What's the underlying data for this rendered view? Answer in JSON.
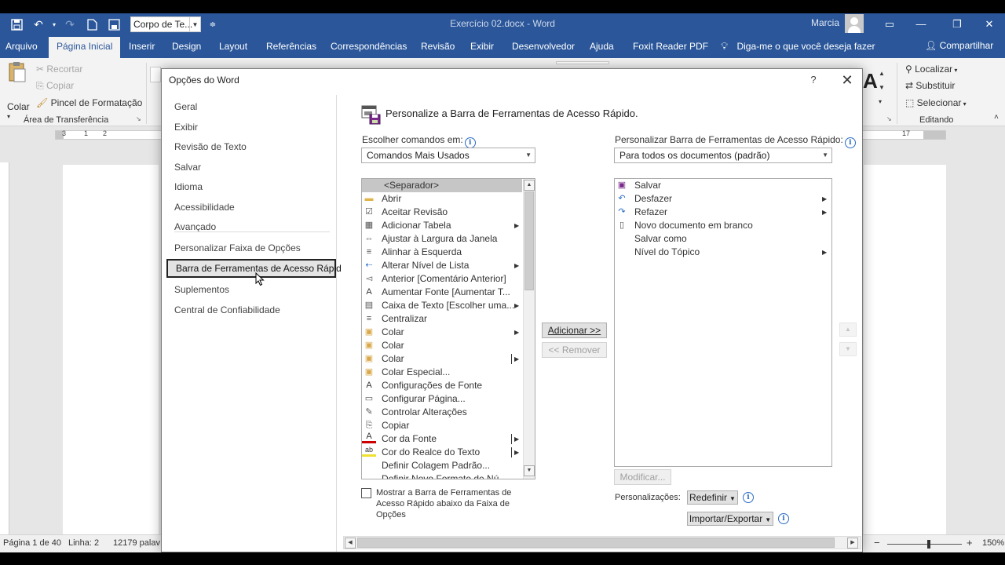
{
  "window": {
    "doc_title": "Exercício 02.docx  -  Word",
    "user": "Marcia",
    "style_box": "Corpo de Te...",
    "controls": {
      "ribbon_options": "▭",
      "minimize": "—",
      "restore": "❐",
      "close": "✕"
    }
  },
  "ribbon_tabs": [
    "Arquivo",
    "Página Inicial",
    "Inserir",
    "Design",
    "Layout",
    "Referências",
    "Correspondências",
    "Revisão",
    "Exibir",
    "Desenvolvedor",
    "Ajuda",
    "Foxit Reader PDF"
  ],
  "tell_me": "Diga-me o que você deseja fazer",
  "share": "Compartilhar",
  "clipboard": {
    "paste": "Colar",
    "cut": "Recortar",
    "copy": "Copiar",
    "format_painter": "Pincel de Formatação",
    "group_label": "Área de Transferência"
  },
  "editing": {
    "find": "Localizar",
    "replace": "Substituir",
    "select": "Selecionar",
    "group_label": "Editando"
  },
  "ruler": {
    "marks": [
      "3",
      "1",
      "2",
      "17"
    ]
  },
  "status": {
    "page": "Página 1 de 40",
    "line": "Linha: 2",
    "words": "12179 palav",
    "zoom": "150%",
    "zoom_minus": "−",
    "zoom_plus": "+"
  },
  "dialog": {
    "title": "Opções do Word",
    "help": "?",
    "close": "✕",
    "nav": {
      "items": [
        "Geral",
        "Exibir",
        "Revisão de Texto",
        "Salvar",
        "Idioma",
        "Acessibilidade",
        "Avançado",
        "Personalizar Faixa de Opções",
        "Barra de Ferramentas de Acesso Rápido",
        "Suplementos",
        "Central de Confiabilidade"
      ],
      "selected_index": 8
    },
    "section_title": "Personalize a Barra de Ferramentas de Acesso Rápido.",
    "choose_label": "Escolher comandos em:",
    "choose_value": "Comandos Mais Usados",
    "customize_label": "Personalizar Barra de Ferramentas de Acesso Rápido:",
    "customize_value": "Para todos os documentos (padrão)",
    "commands": [
      {
        "icon": "",
        "label": "<Separador>",
        "selected": true
      },
      {
        "icon": "folder-icon",
        "label": "Abrir"
      },
      {
        "icon": "accept-revision-icon",
        "label": "Aceitar Revisão"
      },
      {
        "icon": "table-icon",
        "label": "Adicionar Tabela",
        "submenu": true
      },
      {
        "icon": "fit-width-icon",
        "label": "Ajustar à Largura da Janela"
      },
      {
        "icon": "align-left-icon",
        "label": "Alinhar à Esquerda"
      },
      {
        "icon": "list-level-icon",
        "label": "Alterar Nível de Lista",
        "submenu": true
      },
      {
        "icon": "previous-comment-icon",
        "label": "Anterior [Comentário Anterior]"
      },
      {
        "icon": "grow-font-icon",
        "label": "Aumentar Fonte [Aumentar T..."
      },
      {
        "icon": "text-box-icon",
        "label": "Caixa de Texto [Escolher uma...",
        "submenu": true
      },
      {
        "icon": "center-icon",
        "label": "Centralizar"
      },
      {
        "icon": "paste-icon",
        "label": "Colar",
        "submenu": true
      },
      {
        "icon": "paste-icon",
        "label": "Colar"
      },
      {
        "icon": "paste-icon",
        "label": "Colar",
        "submenu": true,
        "split": true
      },
      {
        "icon": "paste-special-icon",
        "label": "Colar Especial..."
      },
      {
        "icon": "font-settings-icon",
        "label": "Configurações de Fonte"
      },
      {
        "icon": "page-setup-icon",
        "label": "Configurar Página..."
      },
      {
        "icon": "track-changes-icon",
        "label": "Controlar Alterações"
      },
      {
        "icon": "copy-icon",
        "label": "Copiar"
      },
      {
        "icon": "font-color-icon",
        "label": "Cor da Fonte",
        "submenu": true,
        "split": true
      },
      {
        "icon": "highlight-icon",
        "label": "Cor do Realce do Texto",
        "submenu": true,
        "split": true
      },
      {
        "icon": "",
        "label": "Definir Colagem Padrão..."
      },
      {
        "icon": "",
        "label": "Definir Novo Formato de Nú..."
      }
    ],
    "qat_items": [
      {
        "icon": "save-icon",
        "label": "Salvar"
      },
      {
        "icon": "undo-icon",
        "label": "Desfazer",
        "submenu": true
      },
      {
        "icon": "redo-icon",
        "label": "Refazer",
        "submenu": true
      },
      {
        "icon": "new-document-icon",
        "label": "Novo documento em branco"
      },
      {
        "icon": "",
        "label": "Salvar como"
      },
      {
        "icon": "",
        "label": "Nível do Tópico",
        "submenu": true
      }
    ],
    "add_button": "Adicionar >>",
    "remove_button": "<< Remover",
    "modify_button": "Modificar...",
    "show_below_label": [
      "Mostrar a Barra de Ferramentas de",
      "Acesso Rápido abaixo da Faixa de",
      "Opções"
    ],
    "customizations_label": "Personalizações:",
    "reset_button": "Redefinir",
    "import_export_button": "Importar/Exportar"
  }
}
